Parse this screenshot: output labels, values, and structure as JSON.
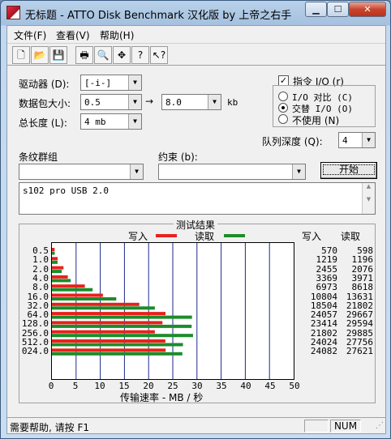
{
  "window": {
    "title": "无标题 - ATTO Disk Benchmark 汉化版 by 上帝之右手"
  },
  "menu": [
    "文件(F)",
    "查看(V)",
    "帮助(H)"
  ],
  "toolbar": [
    "new-icon",
    "open-icon",
    "save-icon",
    "print-icon",
    "print-preview-icon",
    "move-icon",
    "help-icon",
    "context-help-icon"
  ],
  "settings": {
    "drive_label": "驱动器 (D):",
    "drive_value": "[-i-]",
    "transfer_label": "数据包大小:",
    "transfer_from": "0.5",
    "arrow": "→",
    "transfer_to": "8.0",
    "transfer_unit": "kb",
    "length_label": "总长度 (L):",
    "length_value": "4 mb",
    "direct_io_label": "指令 I/O (r)",
    "direct_io_checked": true,
    "io_compare_label": "I/O 对比 (C)",
    "overlapped_label": "交替 I/O (O)",
    "neither_label": "不使用 (N)",
    "queue_label": "队列深度 (Q):",
    "queue_value": "4",
    "stripe_label": "条纹群组",
    "stripe_value": "",
    "constraint_label": "约束 (b):",
    "constraint_value": "",
    "start_button": "开始"
  },
  "description": "s102 pro USB 2.0",
  "results": {
    "title": "测试结果",
    "legend_write": "写入",
    "legend_read": "读取",
    "col_write": "写入",
    "col_read": "读取",
    "xlabel": "传输速率 - MB / 秒",
    "write_color": "#e8211c",
    "read_color": "#1c8c2a"
  },
  "chart_data": {
    "type": "bar",
    "categories": [
      "0.5",
      "1.0",
      "2.0",
      "4.0",
      "8.0",
      "16.0",
      "32.0",
      "64.0",
      "128.0",
      "256.0",
      "512.0",
      "024.0"
    ],
    "series": [
      {
        "name": "写入",
        "values": [
          570,
          1219,
          2455,
          3369,
          6973,
          10804,
          18504,
          24057,
          23414,
          21802,
          24024,
          24082
        ]
      },
      {
        "name": "读取",
        "values": [
          598,
          1196,
          2076,
          3971,
          8618,
          13631,
          21802,
          29667,
          29594,
          29885,
          27756,
          27621
        ]
      }
    ],
    "xlim": [
      0,
      50
    ],
    "xticks": [
      "0",
      "5",
      "10",
      "15",
      "20",
      "25",
      "30",
      "35",
      "40",
      "45",
      "50"
    ],
    "xlabel": "传输速率 - MB / 秒"
  },
  "status": {
    "help_text": "需要帮助, 请按 F1",
    "num": "NUM"
  }
}
